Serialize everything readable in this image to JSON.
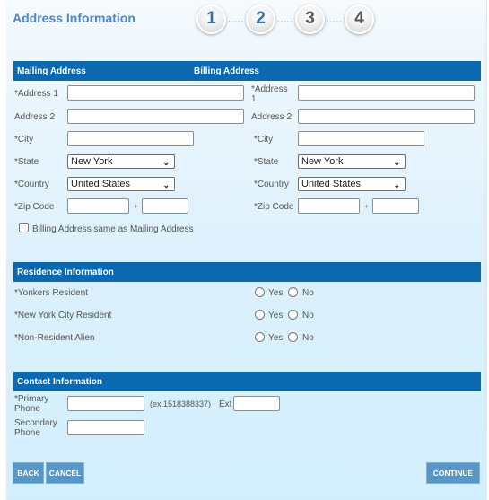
{
  "header": {
    "title": "Address Information",
    "steps": [
      "1",
      "2",
      "3",
      "4"
    ],
    "step_dots": "....."
  },
  "address": {
    "mailing_heading": "Mailing Address",
    "billing_heading": "Billing Address",
    "mailing": {
      "address1_label": "*Address 1",
      "address2_label": "Address 2",
      "city_label": "*City",
      "state_label": "*State",
      "state_value": "New York",
      "country_label": "*Country",
      "country_value": "United States",
      "zip_label": "*Zip Code",
      "zip_separator": "+"
    },
    "billing": {
      "address1_label_line1": "*Address",
      "address1_label_line2": "1",
      "address2_label": "Address 2",
      "city_label": "*City",
      "state_label": "*State",
      "state_value": "New York",
      "country_label": "*Country",
      "country_value": "United States",
      "zip_label": "*Zip Code",
      "zip_separator": "+"
    },
    "same_as_mailing_label": "Billing Address same as Mailing Address",
    "same_as_mailing_checked": false
  },
  "residence": {
    "heading": "Residence Information",
    "questions": [
      {
        "label": "*Yonkers Resident",
        "yes": "Yes",
        "no": "No"
      },
      {
        "label": "*New York City Resident",
        "yes": "Yes",
        "no": "No"
      },
      {
        "label": "*Non-Resident Alien",
        "yes": "Yes",
        "no": "No"
      }
    ]
  },
  "contact": {
    "heading": "Contact Information",
    "primary_label_line1": "*Primary",
    "primary_label_line2": "Phone",
    "primary_hint": "(ex.1518388337)",
    "ext_label": "Ext",
    "secondary_label_line1": "Secondary",
    "secondary_label_line2": "Phone"
  },
  "buttons": {
    "back": "BACK",
    "cancel": "CANCEL",
    "continue": "CONTINUE"
  },
  "colors": {
    "band": "#0a69b0",
    "title": "#4f86c6",
    "button": "#5896c8"
  },
  "icons": {
    "chevron": "chevron-down-icon"
  }
}
